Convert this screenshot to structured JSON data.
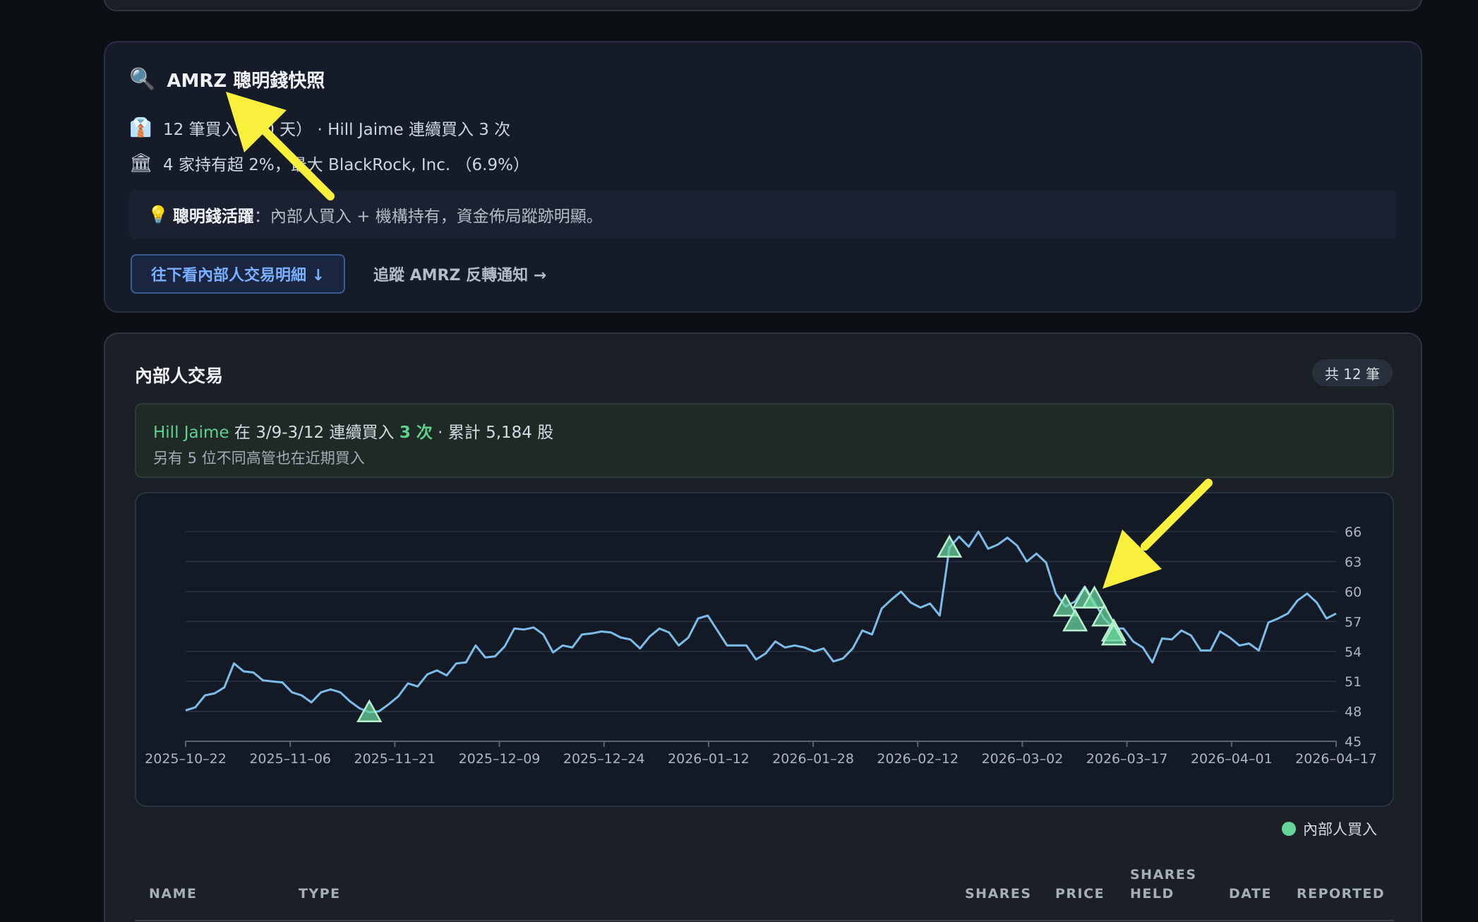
{
  "snapshot": {
    "title_icon": "🔍",
    "title": "AMRZ 聰明錢快照",
    "insider_icon": "👔",
    "insider_line": "12 筆買入（90 天） · Hill Jaime 連續買入 3 次",
    "institution_icon": "🏛",
    "institution_line": "4 家持有超 2%，最大 BlackRock, Inc. （6.9%）",
    "hint_icon": "💡",
    "hint_label": "聰明錢活躍",
    "hint_text": "：內部人買入 + 機構持有，資金佈局蹤跡明顯。",
    "primary_button": "往下看內部人交易明細 ↓",
    "secondary_link": "追蹤 AMRZ 反轉通知 →"
  },
  "insider": {
    "title": "內部人交易",
    "count_badge": "共 12 筆",
    "streak_name": "Hill Jaime",
    "streak_mid": " 在 3/9-3/12 連續買入 ",
    "streak_count": "3 次",
    "streak_tail": " · 累計 5,184 股",
    "streak_sub": "另有 5 位不同高管也在近期買入",
    "legend_label": "內部人買入",
    "table_headers": [
      "NAME",
      "TYPE",
      "SHARES",
      "PRICE",
      "SHARES HELD",
      "DATE",
      "REPORTED"
    ]
  },
  "chart_data": {
    "type": "line",
    "series": [
      {
        "values": [
          48.1,
          48.4,
          49.6,
          49.8,
          50.4,
          52.8,
          52.0,
          51.9,
          51.1,
          51.0,
          50.9,
          49.9,
          49.6,
          48.9,
          49.9,
          50.2,
          49.9,
          49.0,
          48.3,
          47.9,
          48.0,
          48.7,
          49.5,
          50.8,
          50.5,
          51.7,
          52.1,
          51.6,
          52.8,
          52.9,
          54.6,
          53.4,
          53.5,
          54.5,
          56.3,
          56.2,
          56.4,
          55.7,
          53.9,
          54.6,
          54.4,
          55.7,
          55.8,
          56.0,
          55.9,
          55.4,
          55.2,
          54.3,
          55.5,
          56.3,
          55.9,
          54.6,
          55.4,
          57.3,
          57.6,
          56.1,
          54.6,
          54.6,
          54.6,
          53.2,
          53.8,
          55.0,
          54.4,
          54.6,
          54.4,
          54.0,
          54.3,
          53.0,
          53.3,
          54.3,
          56.1,
          55.7,
          58.3,
          59.2,
          60.0,
          58.9,
          58.4,
          58.8,
          57.6,
          64.4,
          65.5,
          64.5,
          66.0,
          64.3,
          64.7,
          65.4,
          64.6,
          63.0,
          63.8,
          62.9,
          59.8,
          58.5,
          59.0,
          60.5,
          58.9,
          57.3,
          56.3,
          56.3,
          55.0,
          54.4,
          52.9,
          55.3,
          55.2,
          56.1,
          55.6,
          54.1,
          54.1,
          56.0,
          55.4,
          54.6,
          54.8,
          54.1,
          56.9,
          57.3,
          57.8,
          59.1,
          59.8,
          58.9,
          57.3,
          57.8
        ]
      }
    ],
    "markers": [
      {
        "index": 19,
        "value": 47.9
      },
      {
        "index": 79,
        "value": 64.4
      },
      {
        "index": 91,
        "value": 58.5
      },
      {
        "index": 92,
        "value": 57.0
      },
      {
        "index": 93,
        "value": 59.3
      },
      {
        "index": 94,
        "value": 59.3
      },
      {
        "index": 95,
        "value": 57.5
      },
      {
        "index": 96,
        "value": 56.0
      },
      {
        "index": 96,
        "value": 55.6
      }
    ],
    "x_tick_labels": [
      "2025–10–22",
      "2025–11–06",
      "2025–11–21",
      "2025–12–09",
      "2025–12–24",
      "2026–01–12",
      "2026–01–28",
      "2026–02–12",
      "2026–03–02",
      "2026–03–17",
      "2026–04–01",
      "2026–04–17"
    ],
    "y_ticks": [
      45,
      48,
      51,
      54,
      57,
      60,
      63,
      66
    ],
    "ylim": [
      45,
      67
    ],
    "grid": true,
    "line_color": "#7bbcea",
    "marker_color": "#66d39b"
  },
  "colors": {
    "accent_blue": "#7ab0ff",
    "positive_green": "#5fd18d",
    "annotation_yellow": "#f8f03c"
  }
}
